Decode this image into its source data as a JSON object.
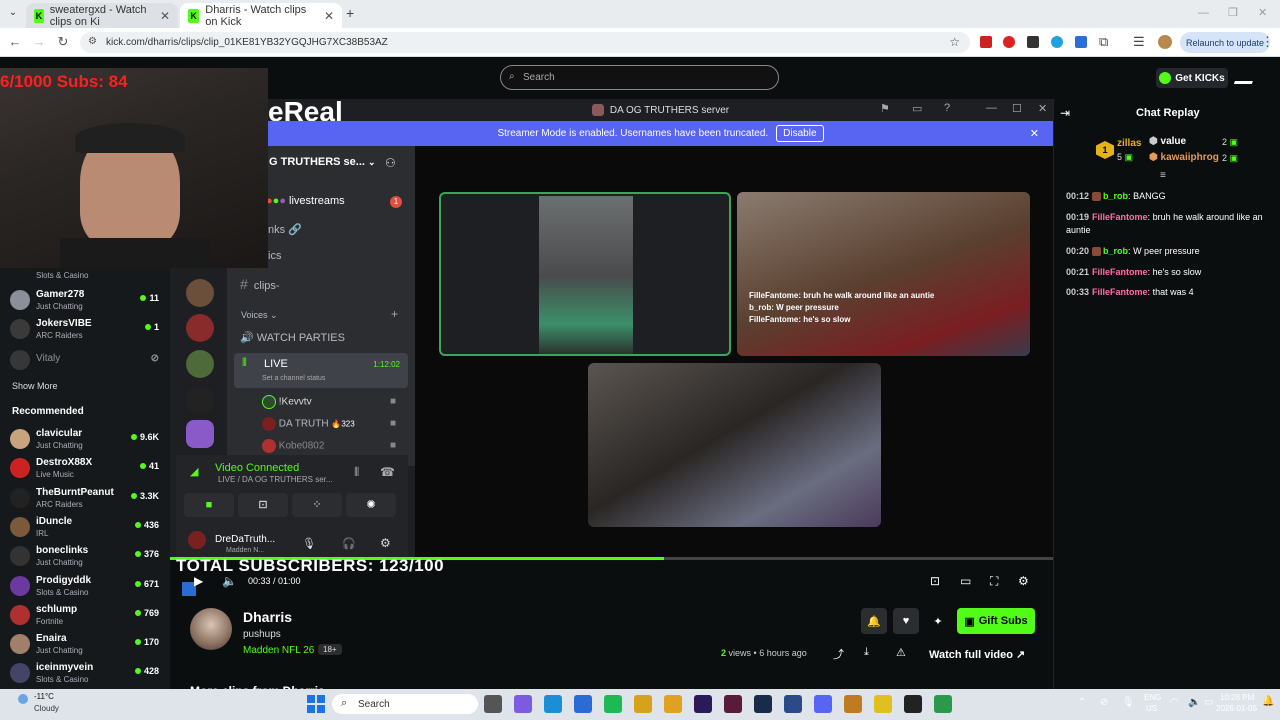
{
  "browser": {
    "tabs": [
      {
        "title": "sweatergxd - Watch clips on Ki",
        "active": false
      },
      {
        "title": "Dharris - Watch clips on Kick",
        "active": true
      }
    ],
    "new_tab": "+",
    "url": "kick.com/dharris/clips/clip_01KE81YB32YGQJHG7XC38B53AZ",
    "relaunch": "Relaunch to update"
  },
  "kick": {
    "search_placeholder": "Search",
    "get_kicks": "Get KICKs",
    "sidebar": {
      "following": [
        {
          "name": "",
          "category": "Slots & Casino",
          "viewers": ""
        },
        {
          "name": "Gamer278",
          "category": "Just Chatting",
          "viewers": "11"
        },
        {
          "name": "JokersVIBE",
          "category": "ARC Raiders",
          "viewers": "1"
        },
        {
          "name": "Vitaly",
          "category": "",
          "viewers": ""
        }
      ],
      "show_more": "Show More",
      "recommended_title": "Recommended",
      "recommended": [
        {
          "name": "clavicular",
          "category": "Just Chatting",
          "viewers": "9.6K",
          "color": "#c9a27e"
        },
        {
          "name": "DestroX88X",
          "category": "Live Music",
          "viewers": "41",
          "color": "#cc2222"
        },
        {
          "name": "TheBurntPeanut",
          "category": "ARC Raiders",
          "viewers": "3.3K",
          "color": "#222222"
        },
        {
          "name": "iDuncle",
          "category": "IRL",
          "viewers": "436",
          "color": "#7a5a3a"
        },
        {
          "name": "boneclinks",
          "category": "Just Chatting",
          "viewers": "376",
          "color": "#333333"
        },
        {
          "name": "Prodigyddk",
          "category": "Slots & Casino",
          "viewers": "671",
          "color": "#6a3aa0"
        },
        {
          "name": "schlump",
          "category": "Fortnite",
          "viewers": "769",
          "color": "#b03030"
        },
        {
          "name": "Enaira",
          "category": "Just Chatting",
          "viewers": "170",
          "color": "#a0806a"
        },
        {
          "name": "iceinmyvein",
          "category": "Slots & Casino",
          "viewers": "428",
          "color": "#444466"
        }
      ]
    },
    "overlay": {
      "cam_text": "6/1000 Subs: 84",
      "total_subs": "TOTAL SUBSCRIBERS: 123/100"
    },
    "discord": {
      "title": "DA OG TRUTHERS server",
      "brand_partial": "eReal_",
      "banner": "Streamer Mode is enabled. Usernames have been truncated.",
      "banner_btn": "Disable",
      "server_name": "G TRUTHERS se...",
      "channels": [
        "livestreams",
        "nks",
        "ics",
        "clips-"
      ],
      "channel_badge": "1",
      "voices_label": "Voices",
      "watch_parties": "WATCH PARTIES",
      "live_channel": "LIVE",
      "live_timer": "1:12:02",
      "live_status": "Set a channel status",
      "voice_users": [
        {
          "name": "!Kevvtv"
        },
        {
          "name": "DA TRUTH",
          "extra": "323"
        },
        {
          "name": "Kobe0802"
        }
      ],
      "video_connected": "Video Connected",
      "video_connected_sub": "LIVE / DA OG TRUTHERS ser...",
      "user_name": "DreDaTruth...",
      "user_sub": "Madden N...",
      "captions": [
        "FilleFantome: bruh he walk around like an auntie",
        "b_rob: W peer pressure",
        "FilleFantome: he's so slow"
      ]
    },
    "player": {
      "time": "00:33 / 01:00",
      "progress": 0.56
    },
    "chat": {
      "title": "Chat Replay",
      "leaders": [
        {
          "rank": "1",
          "name": "zillas",
          "count": "5"
        },
        {
          "name": "value",
          "count": "2"
        },
        {
          "name": "kawaiiphrog",
          "count": "2"
        }
      ],
      "messages": [
        {
          "time": "00:12",
          "user": "b_rob",
          "text": "BANGG",
          "color": "#53fc18"
        },
        {
          "time": "00:19",
          "user": "FilleFantome",
          "text": "bruh he walk around like an auntie",
          "color": "#ff6fa8"
        },
        {
          "time": "00:20",
          "user": "b_rob",
          "text": "W peer pressure",
          "color": "#53fc18"
        },
        {
          "time": "00:21",
          "user": "FilleFantome",
          "text": "he's so slow",
          "color": "#ff6fa8"
        },
        {
          "time": "00:33",
          "user": "FilleFantome",
          "text": "that was 4",
          "color": "#ff6fa8"
        }
      ]
    },
    "clip": {
      "streamer": "Dharris",
      "title": "pushups",
      "category": "Madden NFL 26",
      "rating": "18+",
      "views_num": "2",
      "views_word": "views",
      "age": "6 hours ago",
      "gift_subs": "Gift Subs",
      "watch_full": "Watch full video",
      "more_clips": "More clips from Dharris"
    }
  },
  "taskbar": {
    "weather_temp": "-11°C",
    "weather_desc": "Cloudy",
    "search": "Search",
    "lang": "ENG",
    "region": "US",
    "time": "10:28 PM",
    "date": "2026-01-05"
  },
  "colors": {
    "kick_green": "#53fc18",
    "discord_blurple": "#5865f2"
  }
}
